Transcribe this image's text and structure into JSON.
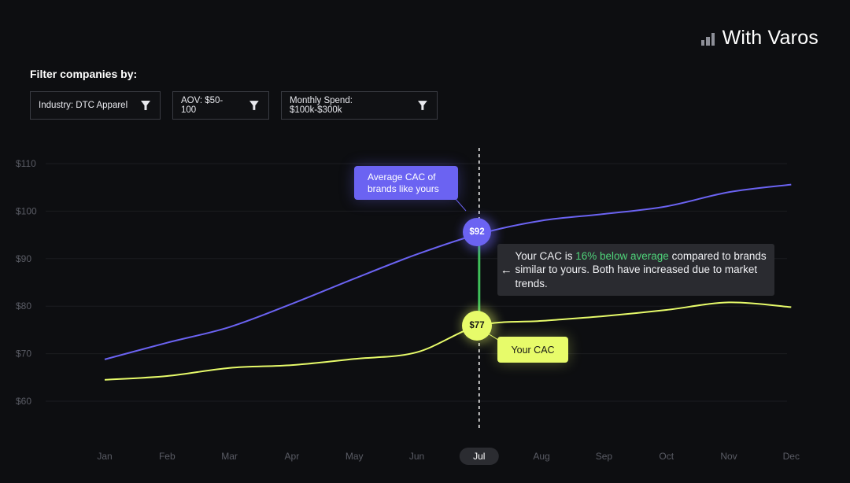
{
  "brand": {
    "name": "With Varos",
    "icon": "bar-chart-icon"
  },
  "filters": {
    "title": "Filter companies by:",
    "items": [
      {
        "label": "Industry: DTC Apparel",
        "icon": "funnel-icon"
      },
      {
        "label": "AOV: $50-100",
        "icon": "funnel-icon"
      },
      {
        "label": "Monthly Spend: $100k-$300k",
        "icon": "funnel-icon"
      }
    ]
  },
  "annotations": {
    "avg_tooltip": "Average CAC of brands like yours",
    "your_tooltip": "Your CAC",
    "avg_marker": "$92",
    "your_marker": "$77",
    "insight_arrow": "←",
    "insight_pre": "Your CAC is ",
    "insight_highlight": "16% below average",
    "insight_post": " compared to brands similar to yours. Both have increased due to market trends."
  },
  "colors": {
    "background": "#0d0e11",
    "average_line": "#6b63f2",
    "your_line": "#e7fb6a",
    "highlight_green": "#4fd47a",
    "connector": "#3fbf5a"
  },
  "chart_data": {
    "type": "line",
    "categories": [
      "Jan",
      "Feb",
      "Mar",
      "Apr",
      "May",
      "Jun",
      "Jul",
      "Aug",
      "Sep",
      "Oct",
      "Nov",
      "Dec"
    ],
    "series": [
      {
        "values": [
          68.8,
          72.3,
          75.6,
          80.5,
          85.8,
          90.9,
          95.2,
          98.0,
          99.4,
          101.0,
          104.0,
          105.6
        ]
      },
      {
        "values": [
          64.5,
          65.3,
          67.0,
          67.6,
          68.9,
          70.3,
          75.9,
          76.9,
          77.9,
          79.2,
          80.8,
          79.8
        ]
      }
    ],
    "highlighted_category": "Jul",
    "y_ticks": [
      "$110",
      "$100",
      "$90",
      "$80",
      "$70",
      "$60"
    ],
    "y_tick_values": [
      110,
      100,
      90,
      80,
      70,
      60
    ],
    "ylim": [
      60,
      110
    ],
    "grid": true
  }
}
